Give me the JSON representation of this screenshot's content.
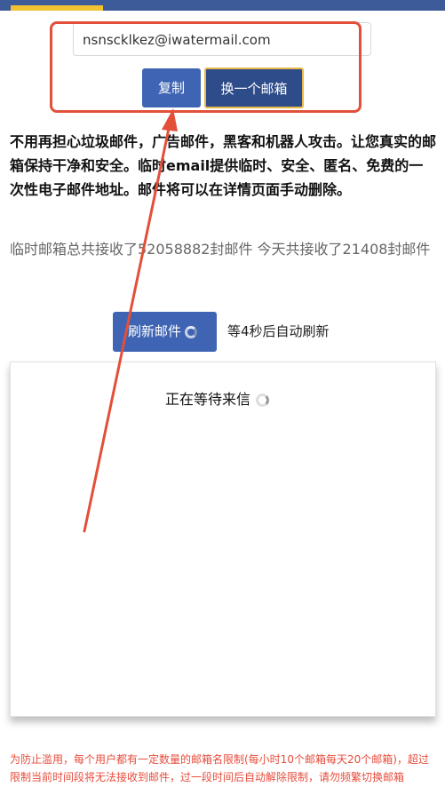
{
  "email": {
    "value": "nsnscklkez@iwatermail.com"
  },
  "actions": {
    "copy_label": "复制",
    "switch_label": "换一个邮箱"
  },
  "description": "不用再担心垃圾邮件，广告邮件，黑客和机器人攻击。让您真实的邮箱保持干净和安全。临时email提供临时、安全、匿名、免费的一次性电子邮件地址。邮件将可以在详情页面手动删除。",
  "stats": "临时邮箱总共接收了52058882封邮件 今天共接收了21408封邮件",
  "refresh": {
    "label": "刷新邮件",
    "countdown": "等4秒后自动刷新"
  },
  "inbox": {
    "waiting": "正在等待来信"
  },
  "notice": "为防止滥用，每个用户都有一定数量的邮箱名限制(每小时10个邮箱每天20个邮箱)，超过限制当前时间段将无法接收到邮件，过一段时间后自动解除限制，请勿频繁切换邮箱",
  "colors": {
    "primary": "#3e64b3",
    "header": "#3d5a99",
    "accent": "#f1c232",
    "annotation": "#e2503a",
    "notice": "#e74c3c"
  }
}
